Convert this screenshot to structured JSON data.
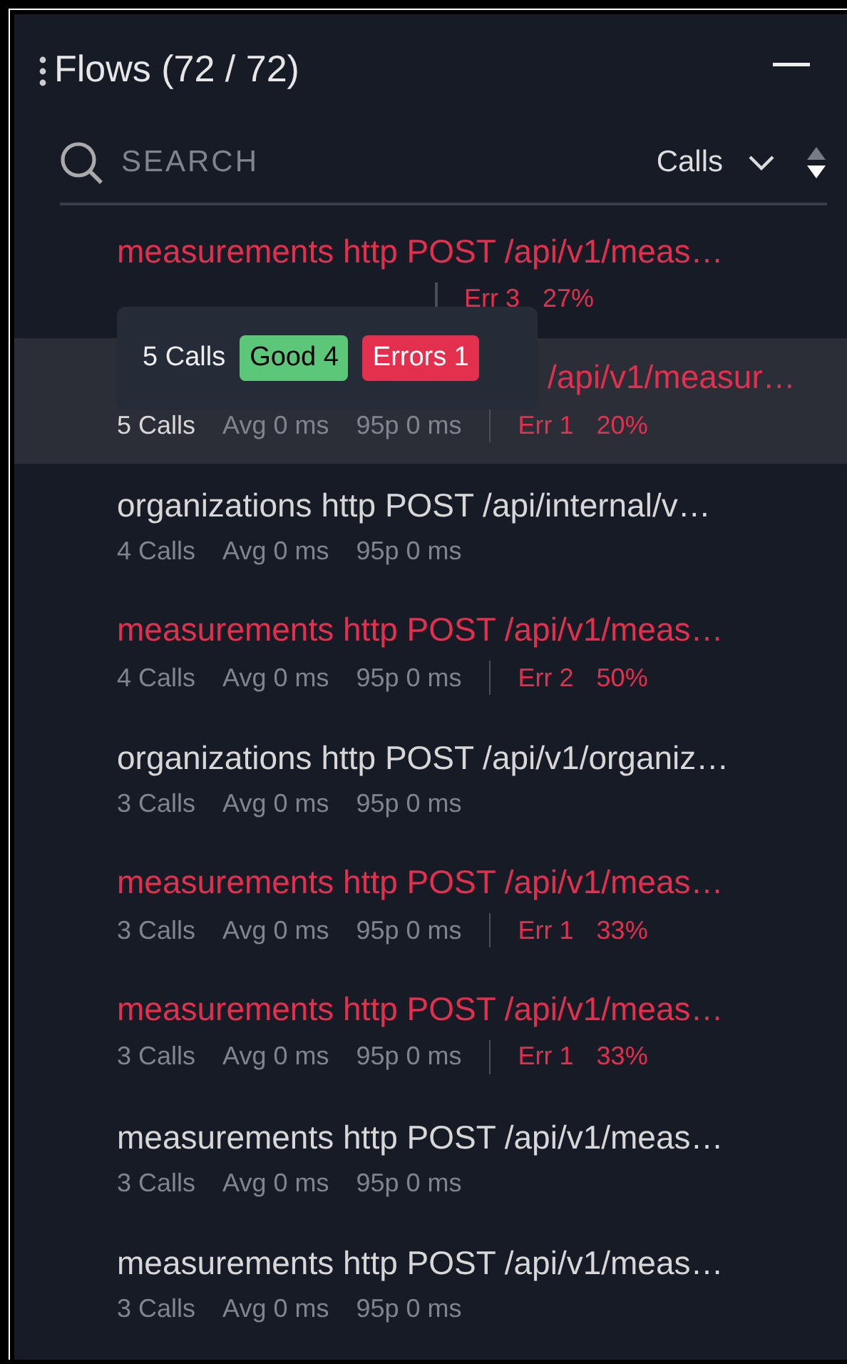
{
  "panel": {
    "title": "Flows (72 / 72)"
  },
  "search": {
    "placeholder": "SEARCH"
  },
  "sort": {
    "label": "Calls"
  },
  "flows": [
    {
      "title": "measurements http POST /api/v1/meas…",
      "error": true,
      "selected": false,
      "err": "Err 3",
      "err_pct": "27%"
    },
    {
      "title": "/api/v1/measur…",
      "error": true,
      "selected": true,
      "calls": "5 Calls",
      "avg": "Avg 0 ms",
      "p95": "95p 0 ms",
      "err": "Err 1",
      "err_pct": "20%"
    },
    {
      "title": "organizations http POST /api/internal/v…",
      "error": false,
      "selected": false,
      "calls": "4 Calls",
      "avg": "Avg 0 ms",
      "p95": "95p 0 ms"
    },
    {
      "title": "measurements http POST /api/v1/meas…",
      "error": true,
      "selected": false,
      "calls": "4 Calls",
      "avg": "Avg 0 ms",
      "p95": "95p 0 ms",
      "err": "Err 2",
      "err_pct": "50%"
    },
    {
      "title": "organizations http POST /api/v1/organiz…",
      "error": false,
      "selected": false,
      "calls": "3 Calls",
      "avg": "Avg 0 ms",
      "p95": "95p 0 ms"
    },
    {
      "title": "measurements http POST /api/v1/meas…",
      "error": true,
      "selected": false,
      "calls": "3 Calls",
      "avg": "Avg 0 ms",
      "p95": "95p 0 ms",
      "err": "Err 1",
      "err_pct": "33%"
    },
    {
      "title": "measurements http POST /api/v1/meas…",
      "error": true,
      "selected": false,
      "calls": "3 Calls",
      "avg": "Avg 0 ms",
      "p95": "95p 0 ms",
      "err": "Err 1",
      "err_pct": "33%"
    },
    {
      "title": "measurements http POST /api/v1/meas…",
      "error": false,
      "selected": false,
      "calls": "3 Calls",
      "avg": "Avg 0 ms",
      "p95": "95p 0 ms"
    },
    {
      "title": "measurements http POST /api/v1/meas…",
      "error": false,
      "selected": false,
      "calls": "3 Calls",
      "avg": "Avg 0 ms",
      "p95": "95p 0 ms"
    }
  ],
  "tooltip": {
    "calls": "5 Calls",
    "good": "Good 4",
    "errors": "Errors 1"
  }
}
